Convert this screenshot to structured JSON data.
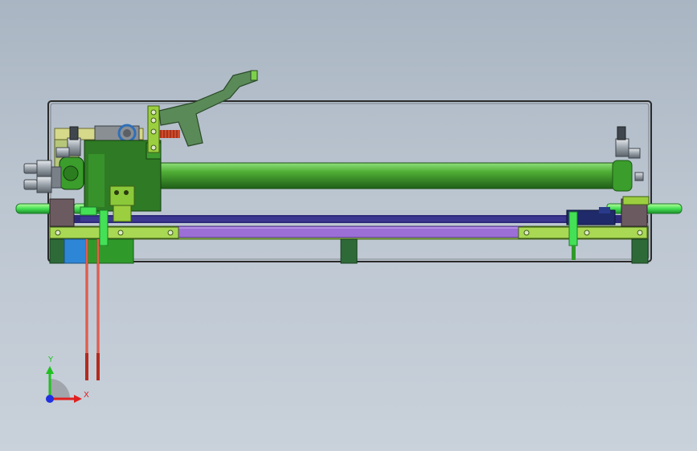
{
  "viewport": {
    "background_top": "#a9b5c2",
    "background_bottom": "#c9d1da"
  },
  "model": {
    "colors": {
      "frame": "#2a2a2a",
      "shaft": "#3f9c2a",
      "shaft_highlight": "#8fe07a",
      "rail": "#9b6fd6",
      "rail_dark": "#2e2a7a",
      "bracket": "#9ccf3f",
      "block_dark": "#2f7a24",
      "lever": "#5a8a58",
      "spring": "#d04a2a",
      "blue_block": "#2e86d6",
      "wires": "#d43a2a",
      "fitting": "#aab0b8",
      "end_cap": "#6b5a60",
      "foot": "#2d6a38",
      "bright_green": "#44e055"
    }
  },
  "triad": {
    "x_label": "X",
    "y_label": "Y",
    "x_color": "#e02020",
    "y_color": "#20c020",
    "z_color": "#2030e0"
  }
}
